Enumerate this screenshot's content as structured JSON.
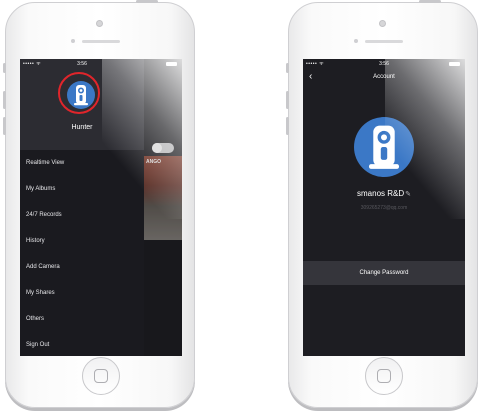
{
  "left_screen": {
    "status": {
      "carrier": "••••• ᯤ",
      "time": "3:56"
    },
    "user": {
      "name": "Hunter"
    },
    "camera_thumb": {
      "label": "ANGO"
    },
    "menu": [
      {
        "label": "Realtime View"
      },
      {
        "label": "My Albums"
      },
      {
        "label": "24/7 Records"
      },
      {
        "label": "History"
      },
      {
        "label": "Add Camera"
      },
      {
        "label": "My Shares"
      },
      {
        "label": "Others"
      },
      {
        "label": "Sign Out"
      }
    ]
  },
  "right_screen": {
    "status": {
      "carrier": "••••• ᯤ",
      "time": "3:56"
    },
    "nav": {
      "back": "‹",
      "title": "Account"
    },
    "account": {
      "name": "smanos R&D",
      "edit_icon": "✎",
      "email": "309265273@qq.com"
    },
    "change_password_label": "Change Password"
  },
  "colors": {
    "drawer_bg": "#1a1a1f",
    "header_bg": "#2c2c32",
    "avatar_blue": "#3b78c6",
    "highlight_ring": "#e0252b"
  },
  "icons": {
    "avatar": "camera-icon",
    "back": "chevron-left-icon",
    "edit": "pencil-icon",
    "wifi": "wifi-icon",
    "battery": "battery-icon"
  }
}
